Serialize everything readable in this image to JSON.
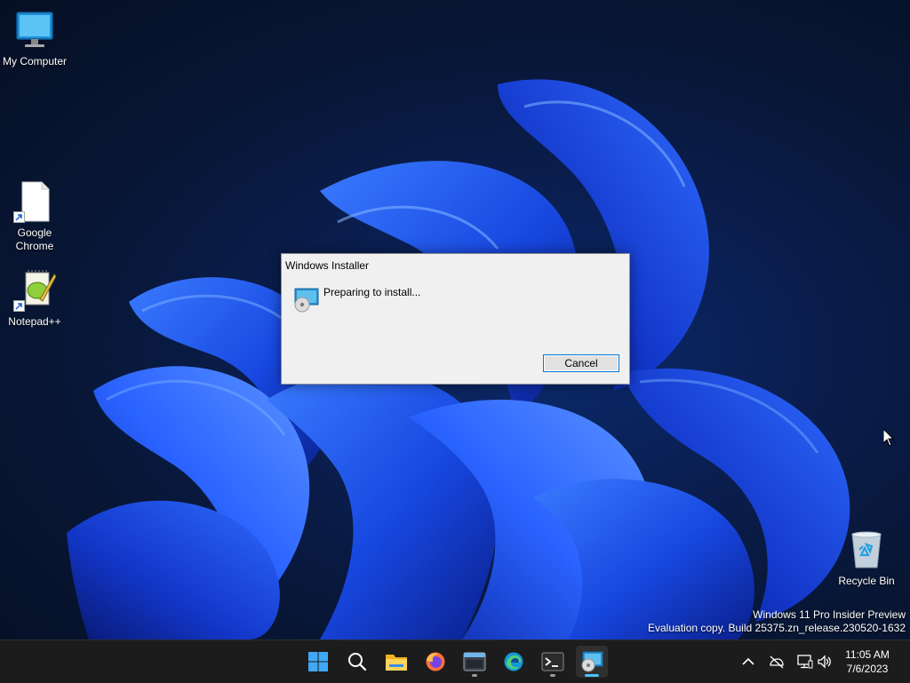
{
  "desktop": {
    "icons": [
      {
        "label": "My Computer",
        "icon": "monitor-icon"
      },
      {
        "label": "Google Chrome",
        "icon": "blank-file-icon",
        "shortcut": true
      },
      {
        "label": "Notepad++",
        "icon": "notepad-plus-plus-icon",
        "shortcut": true
      },
      {
        "label": "Recycle Bin",
        "icon": "recycle-bin-icon"
      }
    ],
    "watermark": {
      "line1": "Windows 11 Pro Insider Preview",
      "line2": "Evaluation copy. Build 25375.zn_release.230520-1632"
    }
  },
  "installer_dialog": {
    "title": "Windows Installer",
    "message": "Preparing to install...",
    "message_icon": "installer-disc-icon",
    "cancel_label": "Cancel"
  },
  "taskbar": {
    "items": [
      {
        "name": "start",
        "icon": "windows-start-icon"
      },
      {
        "name": "search",
        "icon": "search-icon"
      },
      {
        "name": "file-explorer",
        "icon": "folder-icon"
      },
      {
        "name": "firefox",
        "icon": "firefox-icon"
      },
      {
        "name": "app-window",
        "icon": "window-app-icon",
        "running": true
      },
      {
        "name": "edge",
        "icon": "edge-icon"
      },
      {
        "name": "terminal",
        "icon": "terminal-icon",
        "running": true
      },
      {
        "name": "windows-installer",
        "icon": "installer-disc-icon",
        "running": true,
        "active": true
      }
    ],
    "tray": {
      "icons": [
        "chevron-up-icon",
        "network-disconnected-icon",
        "display-icon",
        "volume-icon"
      ],
      "time": "11:05 AM",
      "date": "7/6/2023"
    }
  },
  "colors": {
    "accent": "#0078d7",
    "taskbar": "#1c1c1c",
    "dialog_bg": "#f0f0f0",
    "wallpaper_blue": "#1e5bff"
  }
}
